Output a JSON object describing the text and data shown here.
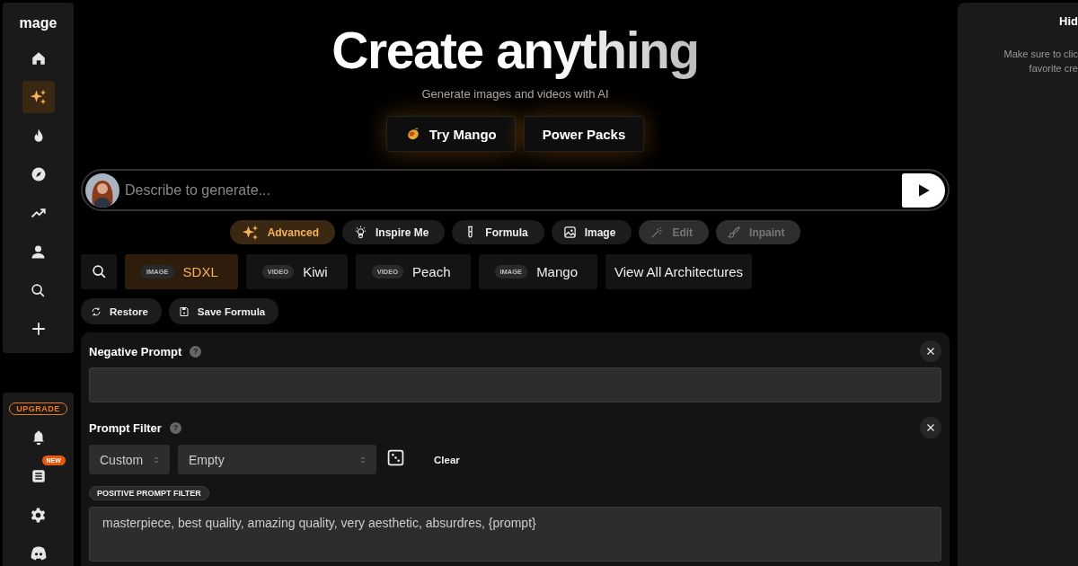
{
  "sidebar": {
    "logo": "mage",
    "items": [
      {
        "selected": false
      },
      {
        "selected": true
      },
      {
        "selected": false
      },
      {
        "selected": false
      },
      {
        "selected": false
      },
      {
        "selected": false
      },
      {
        "selected": false
      },
      {
        "selected": false
      }
    ],
    "upgrade": "UPGRADE",
    "bottom_items": [
      {
        "kind": "bell"
      },
      {
        "kind": "news",
        "badge": "NEW"
      },
      {
        "kind": "gear"
      },
      {
        "kind": "discord"
      }
    ]
  },
  "hero": {
    "title": "Create anything",
    "subtitle": "Generate images and videos with AI",
    "buttons": [
      "Try Mango",
      "Power Packs"
    ]
  },
  "prompt": {
    "placeholder": "Describe to generate..."
  },
  "tools": [
    {
      "label": "Advanced",
      "selected": true,
      "disabled": false
    },
    {
      "label": "Inspire Me",
      "selected": false,
      "disabled": false
    },
    {
      "label": "Formula",
      "selected": false,
      "disabled": false
    },
    {
      "label": "Image",
      "selected": false,
      "disabled": false
    },
    {
      "label": "Edit",
      "selected": false,
      "disabled": true
    },
    {
      "label": "Inpaint",
      "selected": false,
      "disabled": true
    }
  ],
  "models": [
    {
      "type": "IMAGE",
      "name": "SDXL",
      "selected": true
    },
    {
      "type": "VIDEO",
      "name": "Kiwi",
      "selected": false
    },
    {
      "type": "VIDEO",
      "name": "Peach",
      "selected": false
    },
    {
      "type": "IMAGE",
      "name": "Mango",
      "selected": false
    }
  ],
  "view_all": "View All Architectures",
  "actions": [
    "Restore",
    "Save Formula"
  ],
  "settings": {
    "negative_prompt": {
      "label": "Negative Prompt",
      "help": "?"
    },
    "prompt_filter": {
      "label": "Prompt Filter",
      "help": "?",
      "mode": "Custom",
      "preset": "Empty",
      "clear": "Clear",
      "tag": "POSITIVE PROMPT FILTER",
      "value": "masterpiece, best quality, amazing quality, very aesthetic, absurdres, {prompt}"
    }
  },
  "side_panel": {
    "title": "Hid",
    "lines": [
      "Make sure to clic",
      "favorite cre"
    ]
  }
}
